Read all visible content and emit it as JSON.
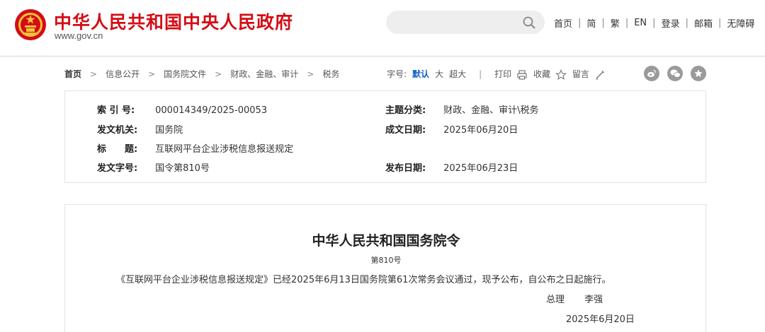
{
  "header": {
    "site_name": "中华人民共和国中央人民政府",
    "site_domain": "www.gov.cn",
    "search_placeholder": "",
    "links": [
      "首页",
      "简",
      "繁",
      "EN",
      "登录",
      "邮箱",
      "无障碍"
    ]
  },
  "breadcrumb": [
    "首页",
    "信息公开",
    "国务院文件",
    "财政、金融、审计",
    "税务"
  ],
  "tools": {
    "font_size_label": "字号:",
    "font_sizes": [
      "默认",
      "大",
      "超大"
    ],
    "print_label": "打印",
    "collect_label": "收藏",
    "comment_label": "留言"
  },
  "social_icons": [
    "weibo-icon",
    "wechat-icon",
    "star-icon"
  ],
  "info": {
    "index_label": "索 引 号:",
    "index_value": "000014349/2025-00053",
    "category_label": "主题分类:",
    "category_value": "财政、金融、审计\\税务",
    "issuer_label": "发文机关:",
    "issuer_value": "国务院",
    "written_date_label": "成文日期:",
    "written_date_value": "2025年06月20日",
    "title_label": "标　　题:",
    "title_value": "互联网平台企业涉税信息报送规定",
    "doc_number_label": "发文字号:",
    "doc_number_value": "国令第810号",
    "publish_date_label": "发布日期:",
    "publish_date_value": "2025年06月23日"
  },
  "document": {
    "title": "中华人民共和国国务院令",
    "number": "第810号",
    "body": "《互联网平台企业涉税信息报送规定》已经2025年6月13日国务院第61次常务会议通过，现予公布，自公布之日起施行。",
    "sign_role": "总理",
    "sign_name": "李强",
    "date": "2025年6月20日"
  },
  "colors": {
    "brand_red": "#d40d15",
    "active_blue": "#1560c8",
    "social_gray": "#9a9a9a"
  }
}
